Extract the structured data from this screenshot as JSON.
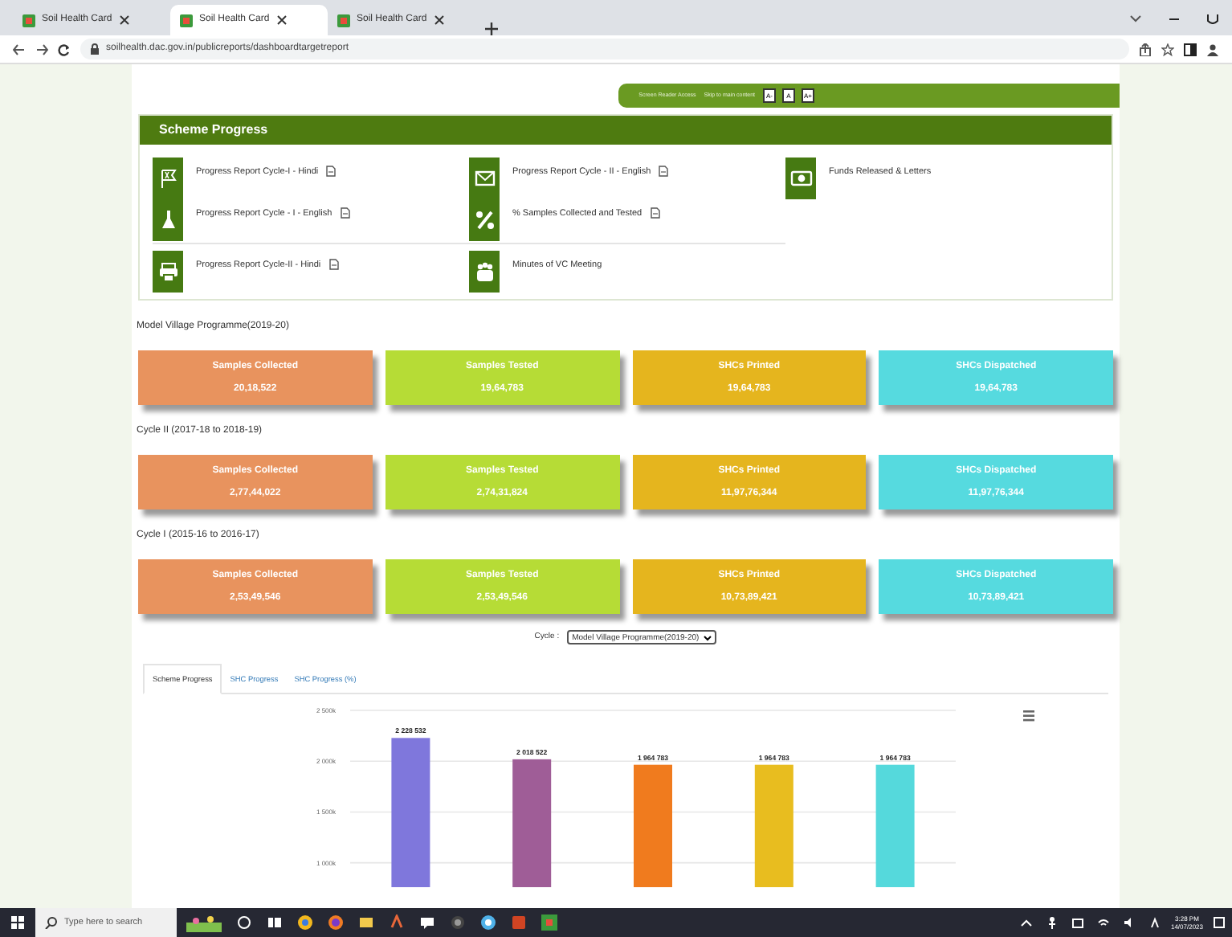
{
  "browser": {
    "tabs": [
      {
        "title": "Soil Health Card",
        "selected": false
      },
      {
        "title": "Soil Health Card",
        "selected": true
      },
      {
        "title": "Soil Health Card",
        "selected": false
      }
    ],
    "url": "soilhealth.dac.gov.in/publicreports/dashboardtargetreport"
  },
  "top_bar": {
    "links": [
      "Screen Reader Access",
      "Skip to main content"
    ],
    "font_buttons": [
      "A-",
      "A",
      "A+"
    ]
  },
  "scheme_progress": {
    "title": "Scheme Progress",
    "columns": [
      [
        {
          "label": "Progress Report Cycle-I - Hindi",
          "has_file": true
        },
        {
          "label": "Progress Report Cycle - I - English",
          "has_file": true
        },
        {
          "label": "Progress Report Cycle-II - Hindi",
          "has_file": true
        }
      ],
      [
        {
          "label": "Progress Report Cycle - II - English",
          "has_file": true
        },
        {
          "label": "% Samples Collected and Tested",
          "has_file": true
        },
        {
          "label": "Minutes of VC Meeting",
          "has_file": false
        }
      ],
      [
        {
          "label": "Funds Released & Letters",
          "has_file": false
        }
      ]
    ]
  },
  "sections": [
    {
      "title": "Model Village Programme(2019-20)",
      "cards": [
        {
          "label": "Samples Collected",
          "value": "20,18,522",
          "color": "#e8935e"
        },
        {
          "label": "Samples Tested",
          "value": "19,64,783",
          "color": "#b6dc36"
        },
        {
          "label": "SHCs Printed",
          "value": "19,64,783",
          "color": "#e5b51e"
        },
        {
          "label": "SHCs Dispatched",
          "value": "19,64,783",
          "color": "#56dadf"
        }
      ]
    },
    {
      "title": "Cycle II (2017-18 to 2018-19)",
      "cards": [
        {
          "label": "Samples Collected",
          "value": "2,77,44,022",
          "color": "#e8935e"
        },
        {
          "label": "Samples Tested",
          "value": "2,74,31,824",
          "color": "#b6dc36"
        },
        {
          "label": "SHCs Printed",
          "value": "11,97,76,344",
          "color": "#e5b51e"
        },
        {
          "label": "SHCs Dispatched",
          "value": "11,97,76,344",
          "color": "#56dadf"
        }
      ]
    },
    {
      "title": "Cycle I (2015-16 to 2016-17)",
      "cards": [
        {
          "label": "Samples Collected",
          "value": "2,53,49,546",
          "color": "#e8935e"
        },
        {
          "label": "Samples Tested",
          "value": "2,53,49,546",
          "color": "#b6dc36"
        },
        {
          "label": "SHCs Printed",
          "value": "10,73,89,421",
          "color": "#e5b51e"
        },
        {
          "label": "SHCs Dispatched",
          "value": "10,73,89,421",
          "color": "#56dadf"
        }
      ]
    }
  ],
  "cycle_filter": {
    "label": "Cycle :",
    "value": "Model Village Programme(2019-20)"
  },
  "chart_tabs": [
    {
      "label": "Scheme Progress",
      "selected": true
    },
    {
      "label": "SHC Progress",
      "selected": false
    },
    {
      "label": "SHC Progress (%)",
      "selected": false
    }
  ],
  "chart_data": {
    "type": "bar",
    "grid": true,
    "values": [
      2228532,
      2018522,
      1964783,
      1964783,
      1964783
    ],
    "colors": [
      "#7f77dc",
      "#9f5d97",
      "#f07b1e",
      "#e8bd1f",
      "#55d9dc"
    ],
    "value_labels": [
      "2 228 532",
      "2 018 522",
      "1 964 783",
      "1 964 783",
      "1 964 783"
    ],
    "ylim": [
      760000,
      2500000
    ],
    "yticks": [
      {
        "value": 2500000,
        "label": "2 500k"
      },
      {
        "value": 2000000,
        "label": "2 000k"
      },
      {
        "value": 1500000,
        "label": "1 500k"
      },
      {
        "value": 1000000,
        "label": "1 000k"
      }
    ]
  },
  "taskbar": {
    "search_placeholder": "Type here to search",
    "time": "3:28 PM",
    "date": "14/07/2023"
  }
}
